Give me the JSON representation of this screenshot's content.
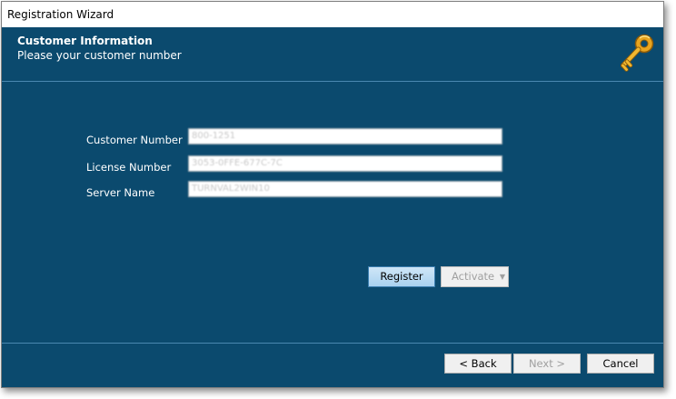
{
  "window": {
    "title": "Registration Wizard"
  },
  "header": {
    "title": "Customer Information",
    "subtitle": "Please your customer number",
    "icon": "key-icon",
    "accent_color": "#0b4a6e"
  },
  "form": {
    "customer_number": {
      "label": "Customer Number",
      "value": "800-1251"
    },
    "license_number": {
      "label": "License Number",
      "value": "3053-0FFE-677C-7C"
    },
    "server_name": {
      "label": "Server Name",
      "value": "TURNVAL2WIN10"
    }
  },
  "actions": {
    "register_label": "Register",
    "activate_label": "Activate"
  },
  "footer": {
    "back_label": "< Back",
    "next_label": "Next >",
    "cancel_label": "Cancel"
  }
}
